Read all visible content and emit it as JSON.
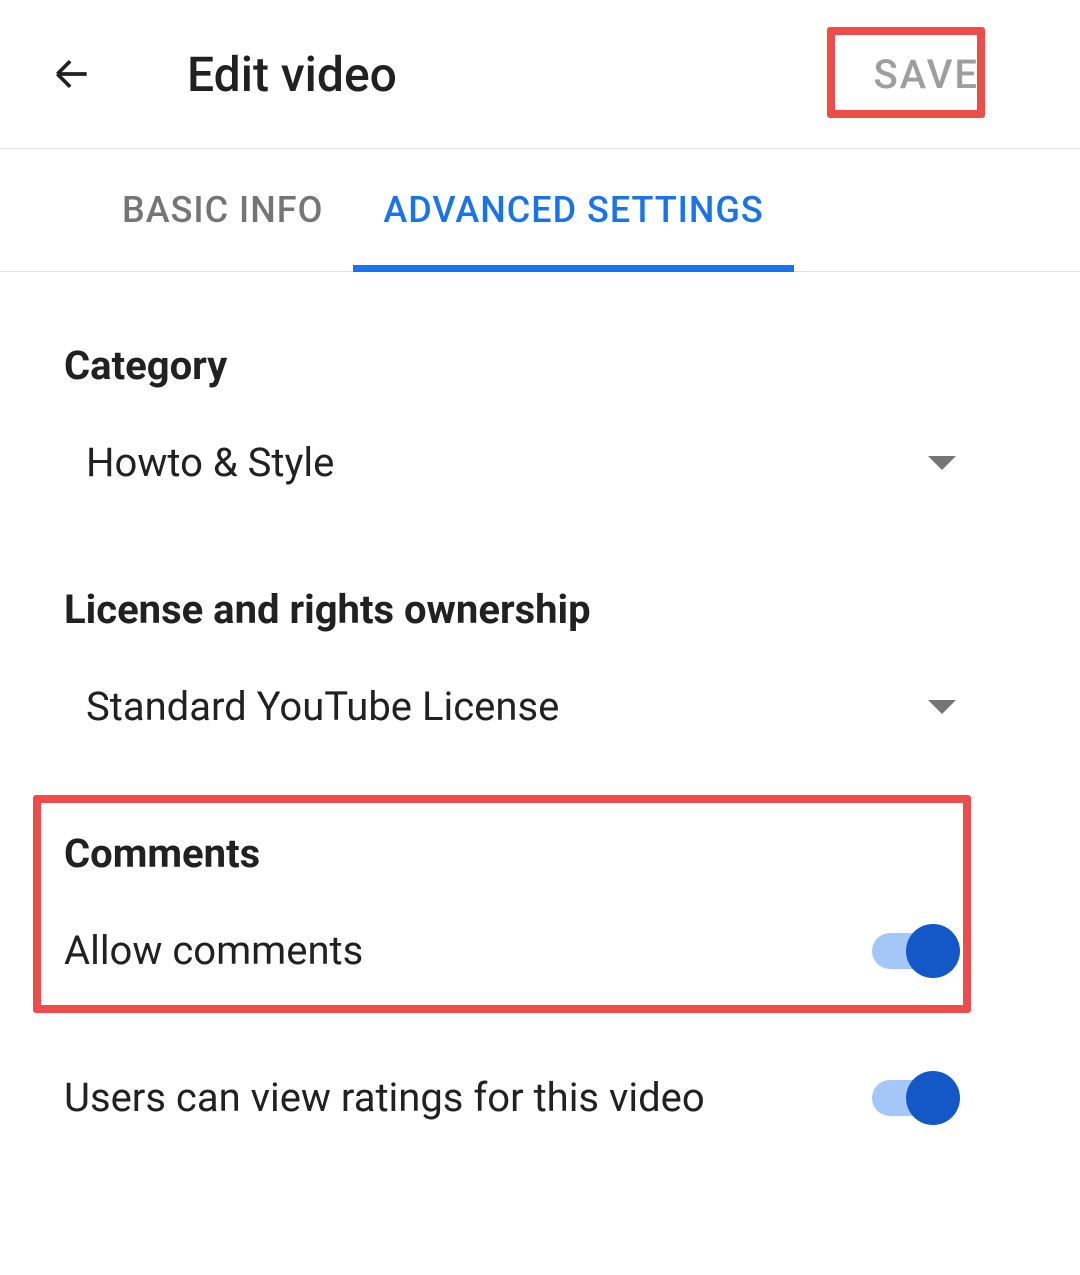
{
  "header": {
    "title": "Edit video",
    "save_label": "SAVE"
  },
  "tabs": {
    "basic_info": "BASIC INFO",
    "advanced_settings": "ADVANCED SETTINGS"
  },
  "sections": {
    "category": {
      "label": "Category",
      "value": "Howto & Style"
    },
    "license": {
      "label": "License and rights ownership",
      "value": "Standard YouTube License"
    },
    "comments": {
      "label": "Comments",
      "allow_comments_label": "Allow comments",
      "allow_comments_value": true,
      "view_ratings_label": "Users can view ratings for this video",
      "view_ratings_value": true
    }
  }
}
